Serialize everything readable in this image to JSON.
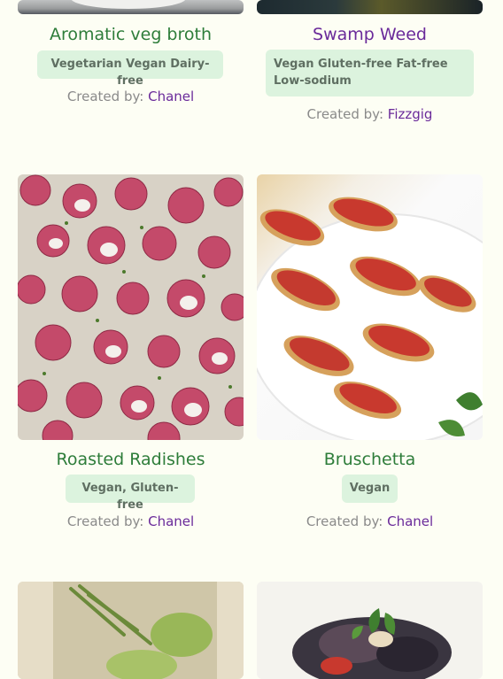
{
  "recipes": [
    {
      "title": "Aromatic veg broth",
      "tags": "Vegetarian Vegan Dairy-free",
      "created_by_label": "Created by:",
      "creator": "Chanel",
      "image": "broth-bowl-photo"
    },
    {
      "title": "Swamp Weed",
      "tags": "Vegan Gluten-free Fat-free Low-sodium",
      "created_by_label": "Created by:",
      "creator": "Fizzgig",
      "image": "swamp-weed-photo"
    },
    {
      "title": "Roasted Radishes",
      "tags": "Vegan, Gluten-free",
      "created_by_label": "Created by:",
      "creator": "Chanel",
      "image": "roasted-radishes-photo"
    },
    {
      "title": "Bruschetta",
      "tags": "Vegan",
      "created_by_label": "Created by:",
      "creator": "Chanel",
      "image": "bruschetta-photo"
    },
    {
      "title": "",
      "image": "asparagus-bake-photo"
    },
    {
      "title": "",
      "image": "eggplant-dish-photo"
    }
  ],
  "colors": {
    "background": "#fdfef4",
    "title_green": "#2e7d3a",
    "title_purple": "#6a2a9a",
    "tag_bg": "#dcf3de",
    "creator_link": "#6a2a9a"
  }
}
